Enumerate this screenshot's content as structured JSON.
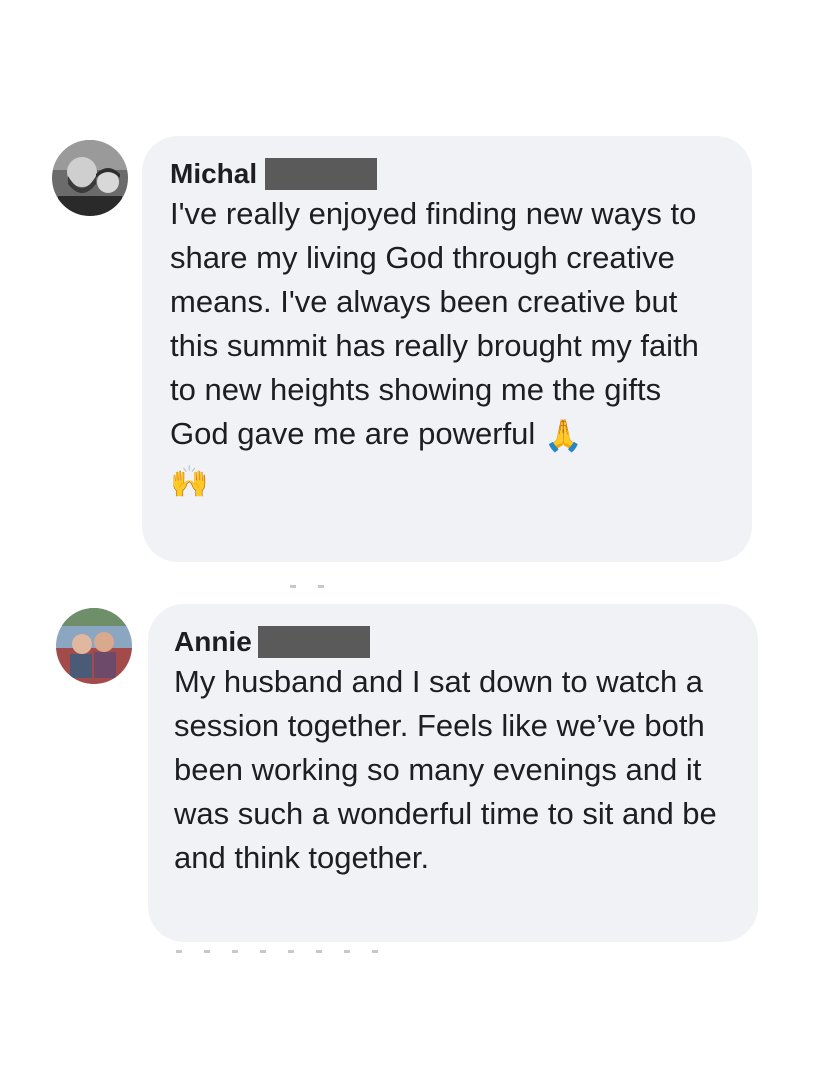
{
  "comments": [
    {
      "author": "Michal",
      "text": "I've really enjoyed finding new ways to share my living God through creative means. I've always been creative but this summit has really brought my faith to new heights showing me the gifts God gave me are powerful",
      "emojis": [
        "🙏",
        "🙌"
      ]
    },
    {
      "author": "Annie",
      "text": "My husband and I sat down to watch a session together. Feels like we’ve both been working so many evenings and it was such a wonderful time to sit and be and think together."
    }
  ]
}
